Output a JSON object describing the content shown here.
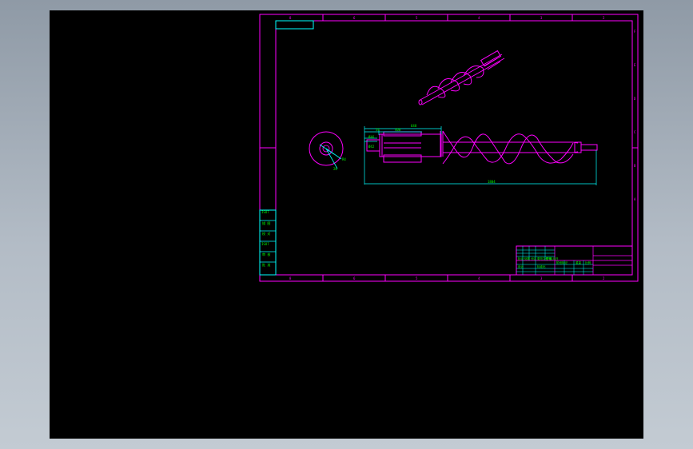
{
  "colors": {
    "background": "#000000",
    "frame": "#ff00ff",
    "dimension": "#00ffff",
    "text": "#00ff00"
  },
  "border": {
    "column_numbers": [
      "8",
      "7",
      "6",
      "5",
      "4",
      "3",
      "2",
      "1"
    ],
    "row_letters": [
      "F",
      "E",
      "D",
      "C",
      "B",
      "A"
    ]
  },
  "dimensions": {
    "overall_length": "1804",
    "left_segment": "648",
    "segment_a": "54",
    "segment_b": "400",
    "small_a": "Ø46",
    "small_b": "Ø42"
  },
  "side_view": {
    "label_a": "R4",
    "label_b": "26"
  },
  "left_panel": {
    "labels": [
      "ISO7",
      "描 图",
      "校 对",
      "ISO7",
      "审 核",
      "批 准"
    ]
  },
  "title_block": {
    "rows": [
      "标记",
      "处数",
      "分区",
      "更改文件号",
      "签名",
      "年月日"
    ],
    "cells": [
      "设计",
      "标准化",
      "阶段标记",
      "重量",
      "比例"
    ]
  }
}
